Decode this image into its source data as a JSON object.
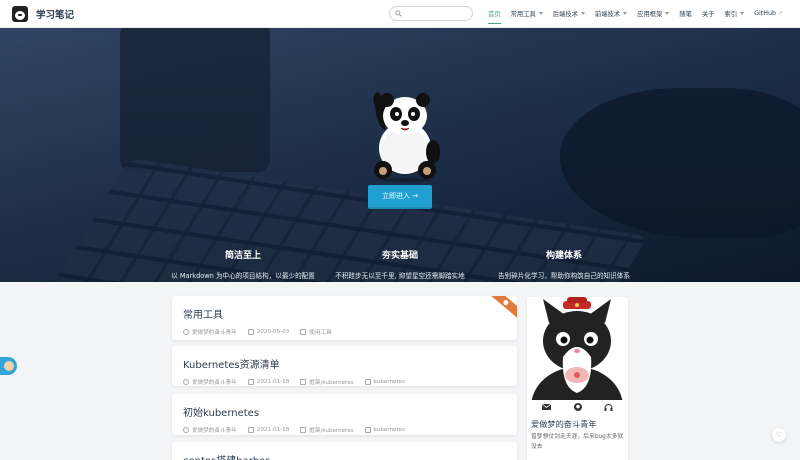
{
  "site": {
    "title": "学习笔记"
  },
  "search": {
    "placeholder": ""
  },
  "nav": {
    "items": [
      {
        "label": "首页",
        "active": true,
        "dropdown": false
      },
      {
        "label": "常用工具",
        "active": false,
        "dropdown": true
      },
      {
        "label": "后端技术",
        "active": false,
        "dropdown": true
      },
      {
        "label": "前端技术",
        "active": false,
        "dropdown": true
      },
      {
        "label": "应用框架",
        "active": false,
        "dropdown": true
      },
      {
        "label": "随笔",
        "active": false,
        "dropdown": false
      },
      {
        "label": "关于",
        "active": false,
        "dropdown": false
      },
      {
        "label": "索引",
        "active": false,
        "dropdown": true
      },
      {
        "label": "GitHub",
        "active": false,
        "dropdown": false,
        "external": true
      }
    ]
  },
  "hero": {
    "cta_label": "立即进入 →",
    "features": [
      {
        "title": "简洁至上",
        "desc": "以 Markdown 为中心的项目结构，以最少的配置帮助你专注于写作。"
      },
      {
        "title": "夯实基础",
        "desc": "不积跬步无以至千里, 抑望星空还需脚踏实地"
      },
      {
        "title": "构建体系",
        "desc": "告别碎片化学习，帮助你构筑自己的知识体系"
      }
    ]
  },
  "posts": [
    {
      "title": "常用工具",
      "author": "爱做梦的奋斗青年",
      "date": "2020-05-03",
      "category": "使用工具",
      "tag": "",
      "sticky": true
    },
    {
      "title": "Kubernetes资源清单",
      "author": "爱做梦的奋斗青年",
      "date": "2021-01-18",
      "category": "框架/kubernetes",
      "tag": "kubernetes",
      "sticky": false
    },
    {
      "title": "初始kubernetes",
      "author": "爱做梦的奋斗青年",
      "date": "2021-01-18",
      "category": "框架/kubernetes",
      "tag": "kubernetes",
      "sticky": false
    },
    {
      "title": "centos搭建harbor",
      "author": "",
      "date": "",
      "category": "",
      "tag": "",
      "sticky": false
    }
  ],
  "sidebar": {
    "name": "爱做梦的奋斗青年",
    "slogan": "曾梦想仗剑走天涯，后来bug太多就没去",
    "icons": [
      "mail-icon",
      "github-icon",
      "headphones-icon"
    ]
  },
  "colors": {
    "accent": "#3eaf7c",
    "cta": "#1f9fd2",
    "ribbon": "#e07b3a",
    "widget": "#36a3d9"
  }
}
